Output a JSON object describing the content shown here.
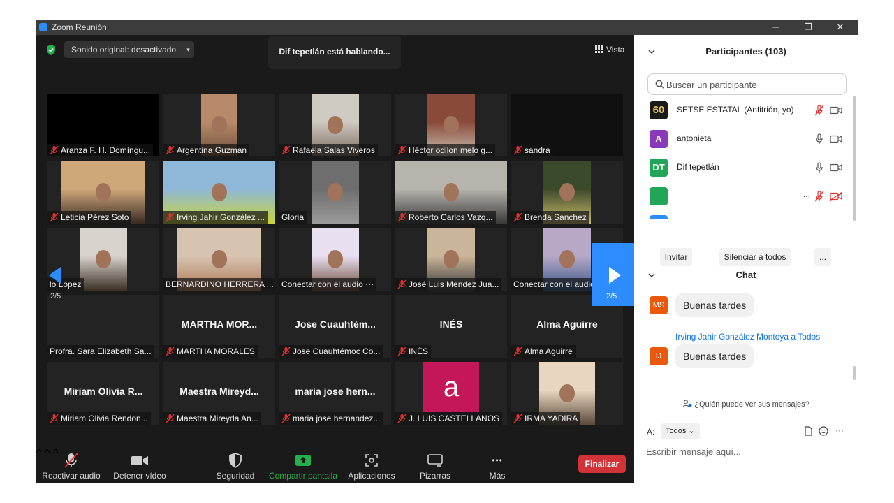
{
  "window": {
    "title": "Zoom Reunión",
    "minimize": "─",
    "restore": "❐",
    "close": "✕"
  },
  "meeting_header": {
    "audio_mode": "Sonido original: desactivado",
    "audio_caret": "▾",
    "speaking_banner": "Dif tepetlán está hablando...",
    "view_label": "Vista"
  },
  "gallery": {
    "page_left": "2/5",
    "page_right": "2/5",
    "tiles": [
      {
        "name": "Aranza F. H. Domíngu...",
        "muted": true
      },
      {
        "name": "Argentina Guzman",
        "muted": true
      },
      {
        "name": "Rafaela Salas Viveros",
        "muted": true
      },
      {
        "name": "Héctor odilon melo g...",
        "muted": true
      },
      {
        "name": "sandra",
        "muted": true
      },
      {
        "name": "Leticia Pérez Soto",
        "muted": true
      },
      {
        "name": "Irving Jahir González ...",
        "muted": true
      },
      {
        "name": "Gloria",
        "muted": false
      },
      {
        "name": "Roberto Carlos Vazq...",
        "muted": true
      },
      {
        "name": "Brenda Sanchez",
        "muted": true
      },
      {
        "name": "lo López",
        "muted": false
      },
      {
        "name": "BERNARDINO HERRERA ...",
        "muted": false
      },
      {
        "name": "Conectar con el audio ⋯",
        "muted": false
      },
      {
        "name": "José Luis Mendez Jua...",
        "muted": true
      },
      {
        "name": "Conectar con el audio",
        "muted": false
      },
      {
        "name": "Profra. Sara Elizabeth Sa...",
        "muted": false,
        "big": ""
      },
      {
        "name": "MARTHA  MORALES",
        "muted": true,
        "big": "MARTHA  MOR..."
      },
      {
        "name": "Jose Cuauhtémoc Co...",
        "muted": true,
        "big": "Jose  Cuauhtém..."
      },
      {
        "name": "INÉS",
        "muted": true,
        "big": "INÉS"
      },
      {
        "name": "Alma Aguirre",
        "muted": true,
        "big": "Alma Aguirre"
      },
      {
        "name": "Miriam Olivia Rendon...",
        "muted": true,
        "big": "Miriam  Olivia  R..."
      },
      {
        "name": "Maestra Mireyda An...",
        "muted": true,
        "big": "Maestra  Mireyd..."
      },
      {
        "name": "maria jose hernandez...",
        "muted": true,
        "big": "maria jose hern..."
      },
      {
        "name": "J. LUIS CASTELLANOS",
        "muted": true,
        "avatar_letter": "a"
      },
      {
        "name": "IRMA YADIRA",
        "muted": true
      }
    ]
  },
  "toolbar": {
    "unmute": "Reactivar audio",
    "stop_video": "Detener vídeo",
    "security": "Seguridad",
    "share": "Compartir pantalla",
    "apps": "Aplicaciones",
    "whiteboards": "Pizarras",
    "more": "Más",
    "end": "Finalizar",
    "more_dots": "•••",
    "caret": "^"
  },
  "participants": {
    "title": "Participantes (103)",
    "search_placeholder": "Buscar un participante",
    "list": [
      {
        "name": "SETSE ESTATAL (Anfitrión, yo)",
        "avatar": "60",
        "avatar_color": "#1a1a1a",
        "mic": "muted",
        "cam": "on"
      },
      {
        "name": "antonieta",
        "avatar": "A",
        "avatar_color": "#8a3ab9",
        "mic": "on",
        "cam": "on"
      },
      {
        "name": "Dif tepetlán",
        "avatar": "DT",
        "avatar_color": "#22a559",
        "mic": "on",
        "cam": "on"
      },
      {
        "name": "",
        "avatar": "",
        "avatar_color": "#22a559",
        "mic": "muted",
        "cam": "off",
        "trailing": "..."
      }
    ],
    "invite": "Invitar",
    "mute_all": "Silenciar a todos",
    "more": "..."
  },
  "chat": {
    "title": "Chat",
    "messages": [
      {
        "initials": "MS",
        "sender": "",
        "text": "Buenas tardes"
      },
      {
        "initials": "IJ",
        "sender": "Irving Jahir González Montoya a Todos",
        "text": "Buenas tardes"
      }
    ],
    "who_can_see": "¿Quién puede ver sus mensajes?",
    "to_label": "A:",
    "to_value": "Todos",
    "to_caret": "⌄",
    "more": "···",
    "input_placeholder": "Escribir mensaje aquí..."
  },
  "colors": {
    "accent": "#2d8cff",
    "end_red": "#d13438",
    "share_green": "#22b14c",
    "muted_red": "#e0302f",
    "link_blue": "#0e71eb"
  }
}
